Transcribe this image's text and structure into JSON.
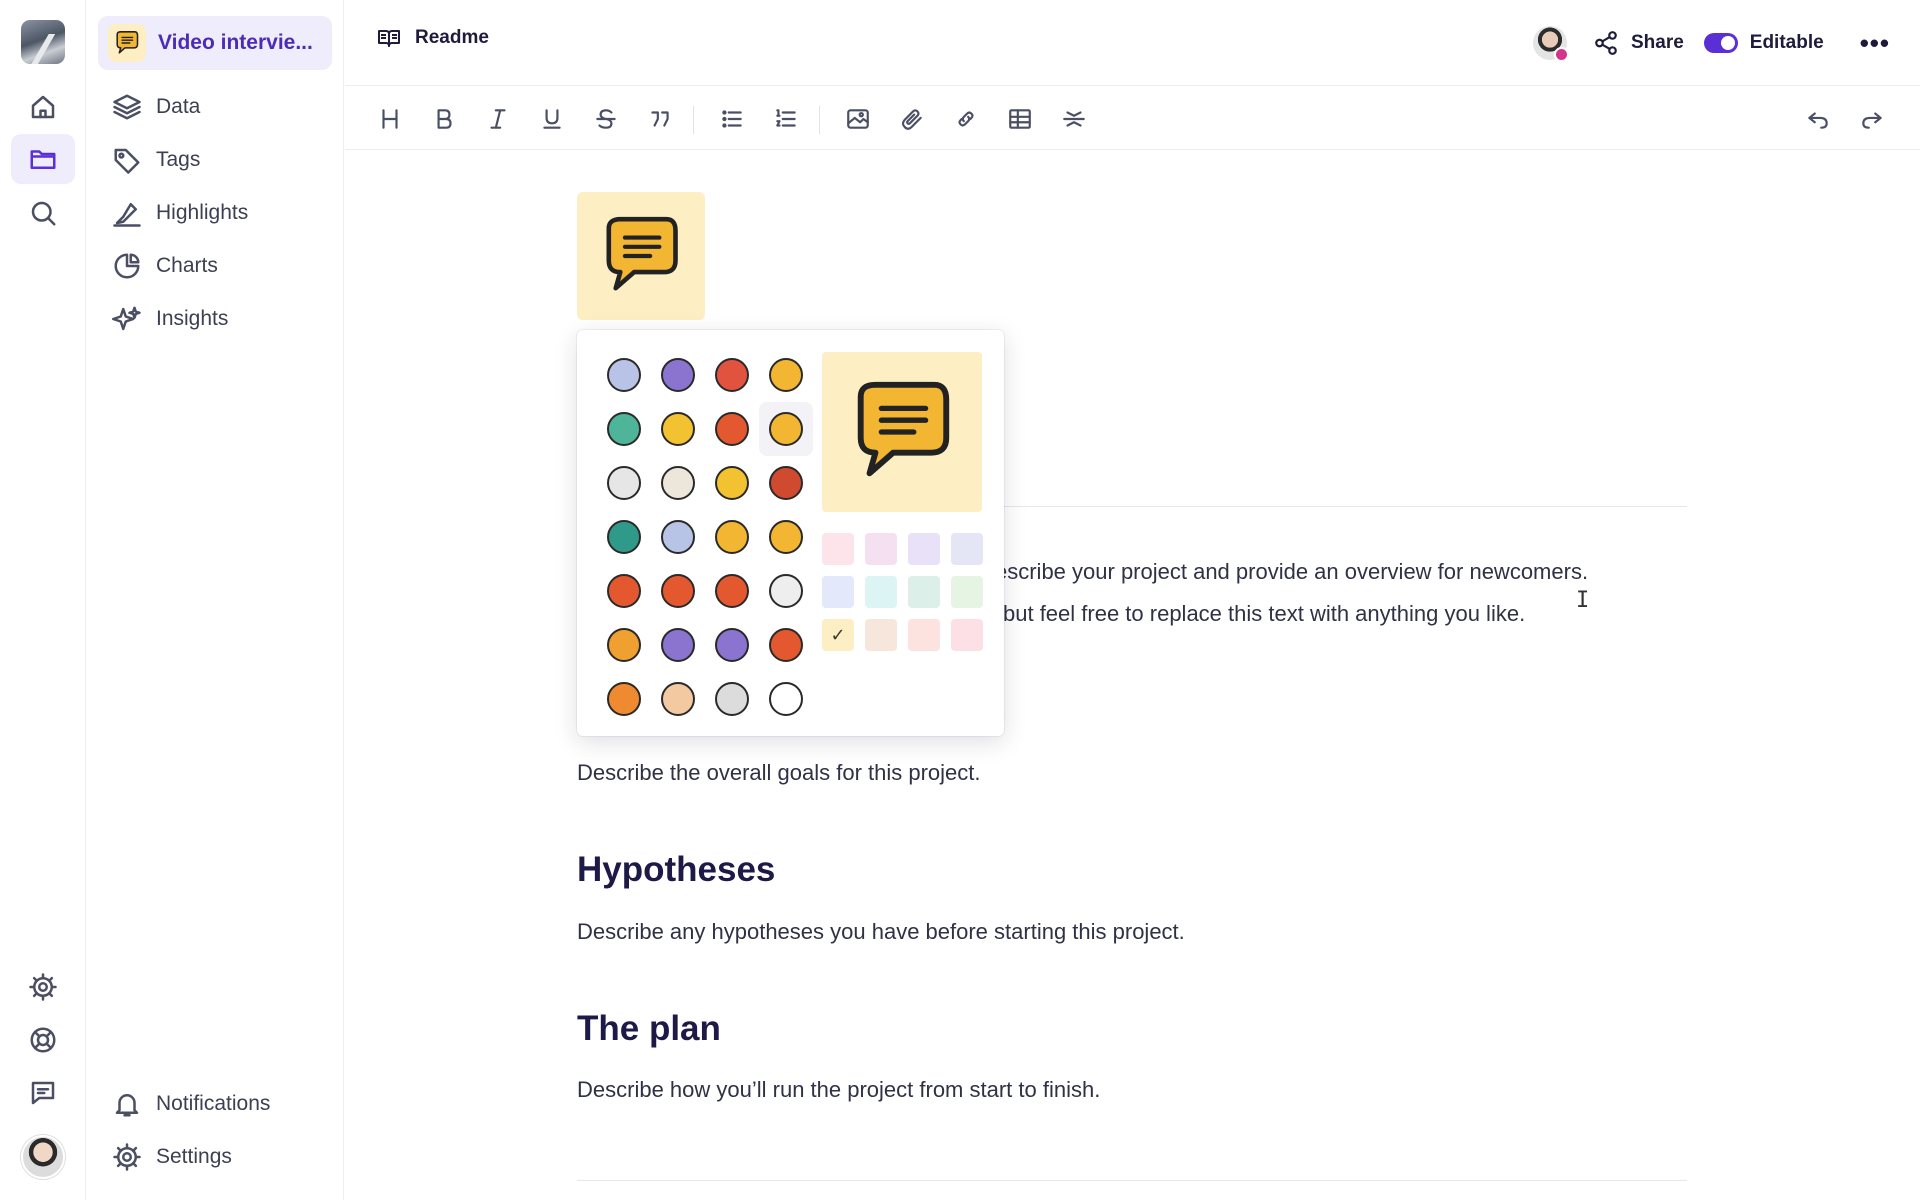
{
  "sidebar": {
    "project_name": "Video intervie...",
    "nav": [
      {
        "label": "Data",
        "icon": "layers-icon"
      },
      {
        "label": "Tags",
        "icon": "tag-icon"
      },
      {
        "label": "Highlights",
        "icon": "highlighter-icon"
      },
      {
        "label": "Charts",
        "icon": "pie-chart-icon"
      },
      {
        "label": "Insights",
        "icon": "sparkles-icon"
      }
    ],
    "bottom": [
      {
        "label": "Notifications",
        "icon": "bell-icon"
      },
      {
        "label": "Settings",
        "icon": "gear-icon"
      }
    ]
  },
  "rail": {
    "items": [
      "home-icon",
      "folder-icon",
      "search-icon"
    ],
    "bottom_items": [
      "settings-icon",
      "help-lifebuoy-icon",
      "feedback-chat-icon"
    ],
    "active": "folder-icon"
  },
  "topbar": {
    "title": "Readme",
    "share_label": "Share",
    "editable_label": "Editable",
    "editable_on": true,
    "more_label": "•••"
  },
  "toolbar": {
    "tools": [
      "heading",
      "bold",
      "italic",
      "underline",
      "strikethrough",
      "quote",
      "bullet-list",
      "numbered-list",
      "image",
      "attachment",
      "link",
      "table",
      "divider",
      "undo",
      "redo"
    ]
  },
  "document": {
    "intro_line1": "escribe your project and provide an overview for newcomers.",
    "intro_line2": "but feel free to replace this text with anything you like.",
    "goals_text": "Describe the overall goals for this project.",
    "h_hypotheses": "Hypotheses",
    "hypotheses_text": "Describe any hypotheses you have before starting this project.",
    "h_plan": "The plan",
    "plan_text": "Describe how you’ll run the project from start to finish."
  },
  "icon_picker": {
    "selected_icon": "speech-bubble",
    "icons": [
      {
        "name": "potion-bottle",
        "color": "#b9c3e8"
      },
      {
        "name": "briefcase",
        "color": "#8a74d0"
      },
      {
        "name": "lifebuoy",
        "color": "#e2533f"
      },
      {
        "name": "shopping-cart",
        "color": "#f2b632"
      },
      {
        "name": "bandage",
        "color": "#4fb59a"
      },
      {
        "name": "phone-device",
        "color": "#f2c230"
      },
      {
        "name": "growth-chart",
        "color": "#e4582f"
      },
      {
        "name": "speech-bubble",
        "color": "#f2b632"
      },
      {
        "name": "diamond",
        "color": "#e6e6e6"
      },
      {
        "name": "document",
        "color": "#ede6da"
      },
      {
        "name": "envelope",
        "color": "#f2c230"
      },
      {
        "name": "fingerprint",
        "color": "#cf4a2f"
      },
      {
        "name": "globe",
        "color": "#2f9a8a"
      },
      {
        "name": "handshake",
        "color": "#b8c4e6"
      },
      {
        "name": "key",
        "color": "#f2b632"
      },
      {
        "name": "lightbulb",
        "color": "#f2b632"
      },
      {
        "name": "megaphone",
        "color": "#e4582f"
      },
      {
        "name": "telephone",
        "color": "#e4582f"
      },
      {
        "name": "puzzle-piece",
        "color": "#e4582f"
      },
      {
        "name": "airplane",
        "color": "#eeeeee"
      },
      {
        "name": "rocket",
        "color": "#f0a030"
      },
      {
        "name": "magnifier",
        "color": "#8a74d0"
      },
      {
        "name": "abacus",
        "color": "#8a74d0"
      },
      {
        "name": "target",
        "color": "#e4582f"
      },
      {
        "name": "fox",
        "color": "#f08a30"
      },
      {
        "name": "cat",
        "color": "#f2c9a0"
      },
      {
        "name": "hedgehog",
        "color": "#dcdcdc"
      },
      {
        "name": "cow",
        "color": "#ffffff"
      }
    ],
    "swatches": [
      {
        "color": "#fce4ea",
        "selected": false
      },
      {
        "color": "#f5e0f2",
        "selected": false
      },
      {
        "color": "#e9e1f8",
        "selected": false
      },
      {
        "color": "#e4e6f6",
        "selected": false
      },
      {
        "color": "#e3e8fb",
        "selected": false
      },
      {
        "color": "#ddf4f4",
        "selected": false
      },
      {
        "color": "#dcefe9",
        "selected": false
      },
      {
        "color": "#e6f4e4",
        "selected": false
      },
      {
        "color": "#fdeec4",
        "selected": true
      },
      {
        "color": "#f6e6dc",
        "selected": false
      },
      {
        "color": "#fce3e0",
        "selected": false
      },
      {
        "color": "#fde0e6",
        "selected": false
      }
    ]
  },
  "colors": {
    "accent": "#5b2fd6",
    "accent_bg": "#efedfb",
    "heading": "#1e1a48"
  }
}
